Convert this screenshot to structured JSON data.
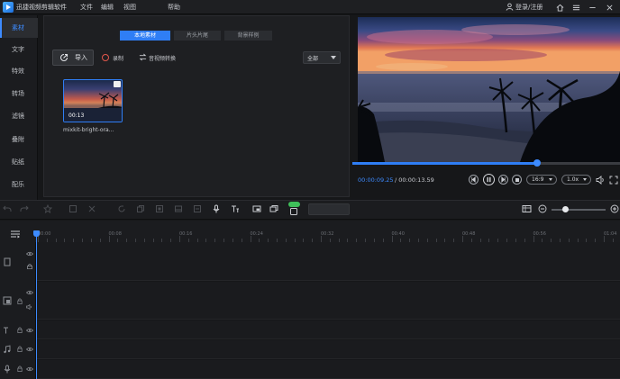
{
  "app": {
    "title": "迅捷视频剪辑软件"
  },
  "menu": {
    "file": "文件",
    "edit": "编辑",
    "view": "视图",
    "help": "帮助"
  },
  "account": {
    "login": "登录/注册"
  },
  "nav": {
    "items": [
      {
        "label": "素材",
        "active": true
      },
      {
        "label": "文字"
      },
      {
        "label": "特效"
      },
      {
        "label": "转场"
      },
      {
        "label": "滤镜"
      },
      {
        "label": "叠附"
      },
      {
        "label": "贴纸"
      },
      {
        "label": "配乐"
      }
    ]
  },
  "media": {
    "tabs": [
      "本地素材",
      "片头片尾",
      "背景样例"
    ],
    "import_label": "导入",
    "record_label": "录制",
    "convert_label": "音视频转换",
    "filter_value": "全部",
    "items": [
      {
        "duration": "00:13",
        "filename": "mixkit-bright-ora..."
      }
    ]
  },
  "player": {
    "current_time": "00:00:09.25",
    "total_time": "/ 00:00:13.59",
    "progress": 0.69,
    "ratio_value": "16:9",
    "speed_value": "1.0x"
  },
  "timeline": {
    "ticks": [
      "00:00",
      "00:08",
      "00:16",
      "00:24",
      "00:32",
      "00:40",
      "00:48",
      "00:56",
      "01:04"
    ],
    "zoom_level": 0.25
  },
  "colors": {
    "accent": "#2f7ef5",
    "new_badge": "#3fbf5a",
    "record": "#e2574c"
  },
  "icons": [
    "app-logo-icon",
    "user-icon",
    "home-icon",
    "menu-icon",
    "minimize-icon",
    "close-icon",
    "import-icon",
    "record-icon",
    "convert-icon",
    "undo-icon",
    "redo-icon",
    "play-icon",
    "pause-icon",
    "volume-icon",
    "fullscreen-icon",
    "eye-icon",
    "lock-icon",
    "timeline-menu-icon",
    "zoom-out-icon",
    "zoom-in-icon"
  ]
}
